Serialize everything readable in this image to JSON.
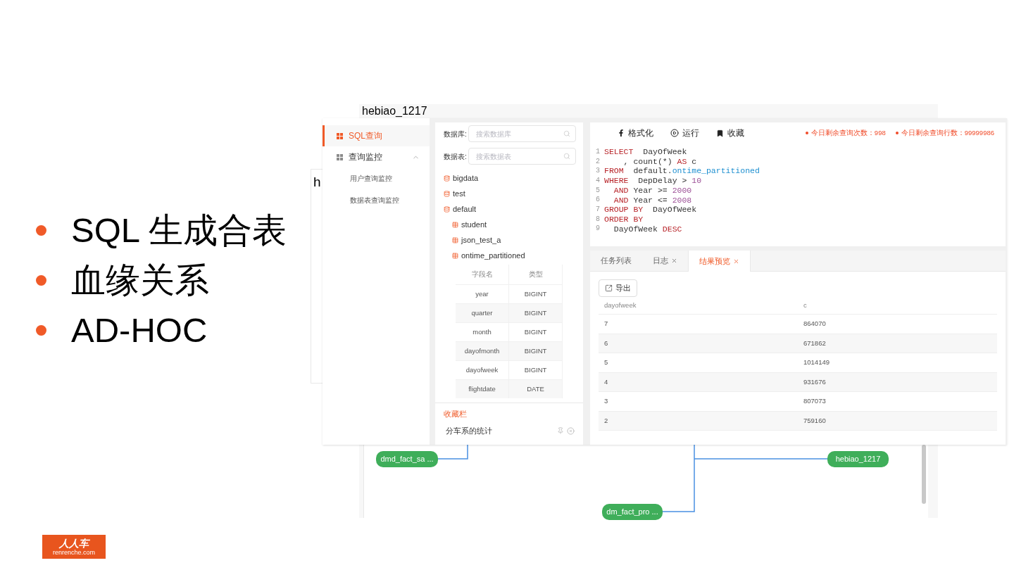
{
  "bullets": [
    {
      "text": "SQL 生成合表"
    },
    {
      "text": "血缘关系"
    },
    {
      "text": "AD-HOC"
    }
  ],
  "logo": {
    "name": "人人车",
    "domain": "renrenche.com"
  },
  "back_window": {
    "title": "h"
  },
  "lineage": {
    "title": "hebiao_1217",
    "nodes": [
      {
        "label": "dmd_fact_sa ..."
      },
      {
        "label": "hebiao_1217"
      },
      {
        "label": "dm_fact_pro ..."
      }
    ]
  },
  "app": {
    "sidebar": {
      "items": [
        {
          "label": "SQL查询",
          "selected": true,
          "expanded": false
        },
        {
          "label": "查询监控",
          "selected": false,
          "expanded": true,
          "children": [
            {
              "label": "用户查询监控",
              "selected": false
            },
            {
              "label": "数据表查询监控",
              "selected": false
            }
          ]
        }
      ]
    },
    "filters": [
      {
        "label": "数据库:",
        "placeholder": "搜索数据库"
      },
      {
        "label": "数据表:",
        "placeholder": "搜索数据表"
      }
    ],
    "tree": [
      {
        "kind": "database",
        "label": "bigdata"
      },
      {
        "kind": "database",
        "label": "test"
      },
      {
        "kind": "database",
        "label": "default"
      },
      {
        "kind": "table",
        "label": "student"
      },
      {
        "kind": "table",
        "label": "json_test_a"
      },
      {
        "kind": "table",
        "label": "ontime_partitioned"
      }
    ],
    "schema": {
      "columns": [
        "字段名",
        "类型"
      ],
      "rows": [
        [
          "year",
          "BIGINT"
        ],
        [
          "quarter",
          "BIGINT"
        ],
        [
          "month",
          "BIGINT"
        ],
        [
          "dayofmonth",
          "BIGINT"
        ],
        [
          "dayofweek",
          "BIGINT"
        ],
        [
          "flightdate",
          "DATE"
        ]
      ]
    },
    "favorites": {
      "title": "收藏栏",
      "items": [
        {
          "label": "分车系的统计"
        }
      ]
    },
    "toolbar": [
      {
        "kind": "format",
        "label": "格式化"
      },
      {
        "kind": "run",
        "label": "运行"
      },
      {
        "kind": "save",
        "label": "收藏"
      }
    ],
    "quotas": [
      "今日剩余查询次数：998",
      "今日剩余查询行数：99999986"
    ],
    "code": [
      {
        "number": "1",
        "tokens": [
          {
            "kind": "keyword",
            "text": "SELECT"
          },
          {
            "kind": "plain",
            "text": "  DayOfWeek"
          }
        ]
      },
      {
        "number": "2",
        "tokens": [
          {
            "kind": "plain",
            "text": "    , count(*) "
          },
          {
            "kind": "keyword",
            "text": "AS"
          },
          {
            "kind": "plain",
            "text": " c"
          }
        ]
      },
      {
        "number": "3",
        "tokens": [
          {
            "kind": "keyword",
            "text": "FROM"
          },
          {
            "kind": "plain",
            "text": "  default."
          },
          {
            "kind": "table",
            "text": "ontime_partitioned"
          }
        ]
      },
      {
        "number": "4",
        "tokens": [
          {
            "kind": "keyword",
            "text": "WHERE"
          },
          {
            "kind": "plain",
            "text": "  DepDelay > "
          },
          {
            "kind": "number",
            "text": "10"
          }
        ]
      },
      {
        "number": "5",
        "tokens": [
          {
            "kind": "keyword",
            "text": "  AND"
          },
          {
            "kind": "plain",
            "text": " Year >= "
          },
          {
            "kind": "number",
            "text": "2000"
          }
        ]
      },
      {
        "number": "6",
        "tokens": [
          {
            "kind": "keyword",
            "text": "  AND"
          },
          {
            "kind": "plain",
            "text": " Year <= "
          },
          {
            "kind": "number",
            "text": "2008"
          }
        ]
      },
      {
        "number": "7",
        "tokens": [
          {
            "kind": "keyword",
            "text": "GROUP BY"
          },
          {
            "kind": "plain",
            "text": "  DayOfWeek"
          }
        ]
      },
      {
        "number": "8",
        "tokens": [
          {
            "kind": "keyword",
            "text": "ORDER BY"
          }
        ]
      },
      {
        "number": "9",
        "tokens": [
          {
            "kind": "plain",
            "text": "  DayOfWeek "
          },
          {
            "kind": "keyword",
            "text": "DESC"
          }
        ]
      }
    ],
    "tabs": [
      {
        "label": "任务列表",
        "closable": false,
        "selected": false
      },
      {
        "label": "日志",
        "closable": true,
        "selected": false
      },
      {
        "label": "结果预览",
        "closable": true,
        "selected": true
      }
    ],
    "export_button": "导出",
    "results": {
      "columns": [
        "dayofweek",
        "c"
      ],
      "rows": [
        [
          "7",
          "864070"
        ],
        [
          "6",
          "671862"
        ],
        [
          "5",
          "1014149"
        ],
        [
          "4",
          "931676"
        ],
        [
          "3",
          "807073"
        ],
        [
          "2",
          "759160"
        ]
      ]
    }
  }
}
